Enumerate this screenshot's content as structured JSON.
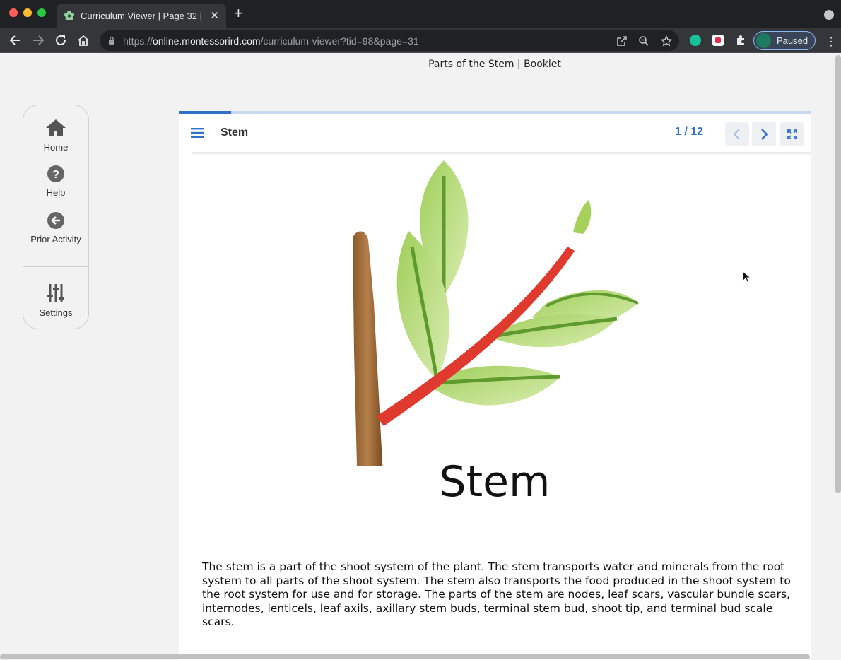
{
  "browser": {
    "tab_title": "Curriculum Viewer | Page 32 | C",
    "url_prefix": "https://",
    "url_host": "online.montessorird.com",
    "url_path": "/curriculum-viewer?tid=98&page=31",
    "profile_label": "Paused",
    "icons": [
      "back-icon",
      "forward-icon",
      "reload-icon",
      "home-icon",
      "lock-icon",
      "open-external-icon",
      "zoom-icon",
      "bookmark-star-icon",
      "grammarly-icon",
      "pocket-icon",
      "extensions-icon",
      "profile-avatar",
      "menu-icon"
    ]
  },
  "header": {
    "title": "Parts of the Stem | Booklet"
  },
  "sidebar": {
    "items": [
      {
        "label": "Home",
        "icon": "home-icon"
      },
      {
        "label": "Help",
        "icon": "help-icon"
      },
      {
        "label": "Prior Activity",
        "icon": "back-arrow-icon"
      },
      {
        "label": "Settings",
        "icon": "sliders-icon"
      }
    ]
  },
  "viewer": {
    "title": "Stem",
    "page_indicator": "1 / 12",
    "progress_fraction": 0.083,
    "accent": "#2f6fce",
    "slide": {
      "heading": "Stem",
      "body": "The stem is a part of the shoot system of the plant. The stem transports water and minerals from the root system to all parts of the shoot system. The stem also transports the food produced in the shoot system to the root system for use and for storage. The parts of the stem are nodes, leaf scars, vascular bundle scars, internodes, lenticels, leaf axils, axillary stem buds, terminal stem bud, shoot tip, and terminal bud scale scars."
    }
  }
}
